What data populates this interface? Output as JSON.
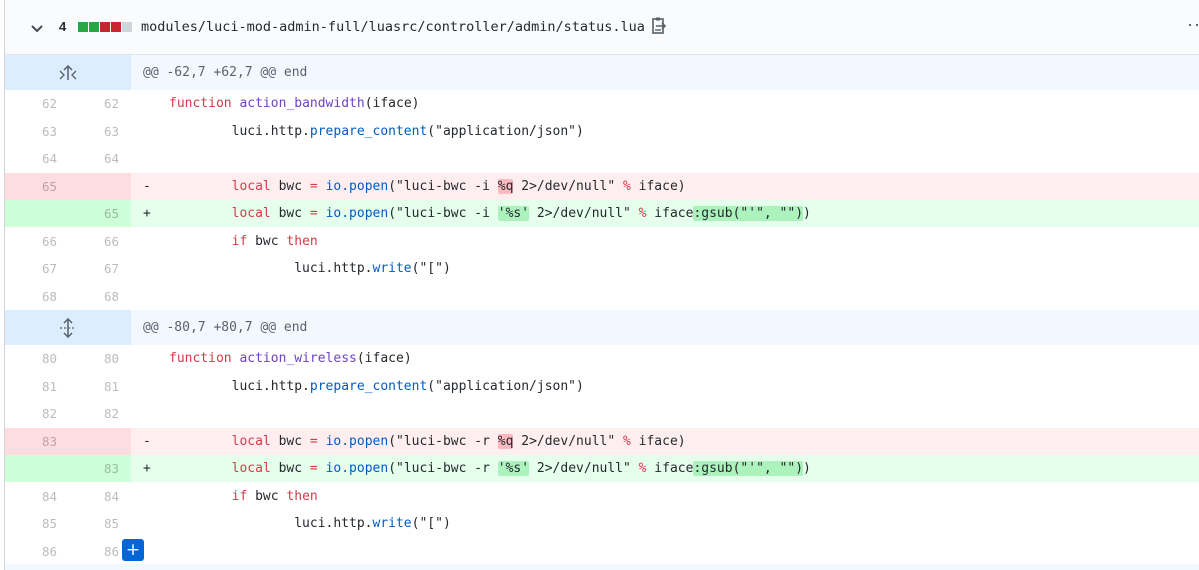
{
  "file": {
    "changes_count": "4",
    "diffstat": [
      "#28a745",
      "#28a745",
      "#cb2431",
      "#cb2431",
      "#d1d5da"
    ],
    "path": "modules/luci-mod-admin-full/luasrc/controller/admin/status.lua",
    "icons": {
      "collapse": "chevron-down-icon",
      "copy": "copy-path-icon",
      "more": "kebab-horizontal-icon"
    },
    "more_label": "···"
  },
  "hunks": [
    {
      "header": "@@ -62,7 +62,7 @@ end",
      "expand_icon": "unfold-up-icon",
      "rows": [
        {
          "type": "ctx",
          "old": "62",
          "new": "62",
          "marker": "",
          "code": [
            {
              "t": "function",
              "c": "kw"
            },
            {
              "t": " "
            },
            {
              "t": "action_bandwidth",
              "c": "fn"
            },
            {
              "t": "(iface)"
            }
          ]
        },
        {
          "type": "ctx",
          "old": "63",
          "new": "63",
          "marker": "",
          "code": [
            {
              "t": "        luci.http."
            },
            {
              "t": "prepare_content",
              "c": "lib"
            },
            {
              "t": "(\"application/json\")"
            }
          ]
        },
        {
          "type": "ctx",
          "old": "64",
          "new": "64",
          "marker": "",
          "code": []
        },
        {
          "type": "del",
          "old": "65",
          "new": "",
          "marker": "-",
          "code": [
            {
              "t": "        "
            },
            {
              "t": "local",
              "c": "kw"
            },
            {
              "t": " bwc "
            },
            {
              "t": "=",
              "c": "kw"
            },
            {
              "t": " "
            },
            {
              "t": "io.popen",
              "c": "lib"
            },
            {
              "t": "(\"luci-bwc -i "
            },
            {
              "t": "%q",
              "c": "hl-del"
            },
            {
              "t": " 2>/dev/null\" "
            },
            {
              "t": "%",
              "c": "kw"
            },
            {
              "t": " iface)"
            }
          ]
        },
        {
          "type": "add",
          "old": "",
          "new": "65",
          "marker": "+",
          "code": [
            {
              "t": "        "
            },
            {
              "t": "local",
              "c": "kw"
            },
            {
              "t": " bwc "
            },
            {
              "t": "=",
              "c": "kw"
            },
            {
              "t": " "
            },
            {
              "t": "io.popen",
              "c": "lib"
            },
            {
              "t": "(\"luci-bwc -i "
            },
            {
              "t": "'%s'",
              "c": "hl-add"
            },
            {
              "t": " 2>/dev/null\" "
            },
            {
              "t": "%",
              "c": "kw"
            },
            {
              "t": " iface"
            },
            {
              "t": ":gsub(\"'\", \"\")",
              "c": "hl-add"
            },
            {
              "t": ")"
            }
          ]
        },
        {
          "type": "ctx",
          "old": "66",
          "new": "66",
          "marker": "",
          "code": [
            {
              "t": "        "
            },
            {
              "t": "if",
              "c": "kw"
            },
            {
              "t": " bwc "
            },
            {
              "t": "then",
              "c": "kw"
            }
          ]
        },
        {
          "type": "ctx",
          "old": "67",
          "new": "67",
          "marker": "",
          "code": [
            {
              "t": "                luci.http."
            },
            {
              "t": "write",
              "c": "lib"
            },
            {
              "t": "(\"[\")"
            }
          ]
        },
        {
          "type": "ctx",
          "old": "68",
          "new": "68",
          "marker": "",
          "code": []
        }
      ]
    },
    {
      "header": "@@ -80,7 +80,7 @@ end",
      "expand_icon": "unfold-icon",
      "rows": [
        {
          "type": "ctx",
          "old": "80",
          "new": "80",
          "marker": "",
          "code": [
            {
              "t": "function",
              "c": "kw"
            },
            {
              "t": " "
            },
            {
              "t": "action_wireless",
              "c": "fn"
            },
            {
              "t": "(iface)"
            }
          ]
        },
        {
          "type": "ctx",
          "old": "81",
          "new": "81",
          "marker": "",
          "code": [
            {
              "t": "        luci.http."
            },
            {
              "t": "prepare_content",
              "c": "lib"
            },
            {
              "t": "(\"application/json\")"
            }
          ]
        },
        {
          "type": "ctx",
          "old": "82",
          "new": "82",
          "marker": "",
          "code": []
        },
        {
          "type": "del",
          "old": "83",
          "new": "",
          "marker": "-",
          "code": [
            {
              "t": "        "
            },
            {
              "t": "local",
              "c": "kw"
            },
            {
              "t": " bwc "
            },
            {
              "t": "=",
              "c": "kw"
            },
            {
              "t": " "
            },
            {
              "t": "io.popen",
              "c": "lib"
            },
            {
              "t": "(\"luci-bwc -r "
            },
            {
              "t": "%q",
              "c": "hl-del"
            },
            {
              "t": " 2>/dev/null\" "
            },
            {
              "t": "%",
              "c": "kw"
            },
            {
              "t": " iface)"
            }
          ]
        },
        {
          "type": "add",
          "old": "",
          "new": "83",
          "marker": "+",
          "code": [
            {
              "t": "        "
            },
            {
              "t": "local",
              "c": "kw"
            },
            {
              "t": " bwc "
            },
            {
              "t": "=",
              "c": "kw"
            },
            {
              "t": " "
            },
            {
              "t": "io.popen",
              "c": "lib"
            },
            {
              "t": "(\"luci-bwc -r "
            },
            {
              "t": "'%s'",
              "c": "hl-add"
            },
            {
              "t": " 2>/dev/null\" "
            },
            {
              "t": "%",
              "c": "kw"
            },
            {
              "t": " iface"
            },
            {
              "t": ":gsub(\"'\", \"\")",
              "c": "hl-add"
            },
            {
              "t": ")"
            }
          ]
        },
        {
          "type": "ctx",
          "old": "84",
          "new": "84",
          "marker": "",
          "code": [
            {
              "t": "        "
            },
            {
              "t": "if",
              "c": "kw"
            },
            {
              "t": " bwc "
            },
            {
              "t": "then",
              "c": "kw"
            }
          ]
        },
        {
          "type": "ctx",
          "old": "85",
          "new": "85",
          "marker": "",
          "code": [
            {
              "t": "                luci.http."
            },
            {
              "t": "write",
              "c": "lib"
            },
            {
              "t": "(\"[\")"
            }
          ]
        },
        {
          "type": "ctx",
          "old": "86",
          "new": "86",
          "marker": "",
          "code": []
        }
      ]
    }
  ],
  "add_comment": {
    "label": "+",
    "icon": "plus-icon"
  }
}
